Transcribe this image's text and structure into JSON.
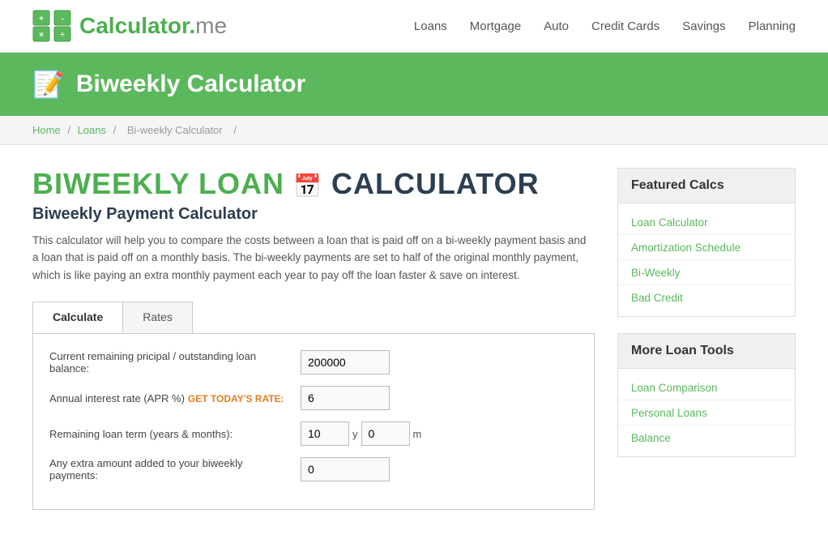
{
  "header": {
    "logo_text": "Calculator",
    "logo_dot": ".",
    "logo_me": "me",
    "nav_items": [
      {
        "label": "Loans",
        "href": "#"
      },
      {
        "label": "Mortgage",
        "href": "#"
      },
      {
        "label": "Auto",
        "href": "#"
      },
      {
        "label": "Credit Cards",
        "href": "#"
      },
      {
        "label": "Savings",
        "href": "#"
      },
      {
        "label": "Planning",
        "href": "#"
      }
    ]
  },
  "banner": {
    "emoji": "📝",
    "title": "Biweekly Calculator"
  },
  "breadcrumb": {
    "home": "Home",
    "loans": "Loans",
    "current": "Bi-weekly Calculator"
  },
  "main": {
    "heading_part1": "BIWEEKLY LOAN",
    "heading_emoji": "📅",
    "heading_part2": "CALCULATOR",
    "subheading": "Biweekly Payment Calculator",
    "description": "This calculator will help you to compare the costs between a loan that is paid off on a bi-weekly payment basis and a loan that is paid off on a monthly basis. The bi-weekly payments are set to half of the original monthly payment, which is like paying an extra monthly payment each year to pay off the loan faster & save on interest.",
    "tabs": [
      {
        "label": "Calculate",
        "active": true
      },
      {
        "label": "Rates",
        "active": false
      }
    ],
    "form_fields": [
      {
        "label": "Current remaining pricipal / outstanding loan balance:",
        "type": "single",
        "value": "200000",
        "placeholder": ""
      },
      {
        "label": "Annual interest rate (APR %)",
        "get_rate_label": "GET TODAY'S RATE:",
        "type": "single",
        "value": "6",
        "placeholder": ""
      },
      {
        "label": "Remaining loan term (years & months):",
        "type": "dual",
        "value1": "10",
        "unit1": "y",
        "value2": "0",
        "unit2": "m"
      },
      {
        "label": "Any extra amount added to your biweekly payments:",
        "type": "single",
        "value": "0",
        "placeholder": ""
      }
    ]
  },
  "sidebar": {
    "featured_calcs": {
      "header": "Featured Calcs",
      "items": [
        {
          "label": "Loan Calculator",
          "href": "#"
        },
        {
          "label": "Amortization Schedule",
          "href": "#"
        },
        {
          "label": "Bi-Weekly",
          "href": "#"
        },
        {
          "label": "Bad Credit",
          "href": "#"
        }
      ]
    },
    "more_loan_tools": {
      "header": "More Loan Tools",
      "items": [
        {
          "label": "Loan Comparison",
          "href": "#"
        },
        {
          "label": "Personal Loans",
          "href": "#"
        },
        {
          "label": "Balance",
          "href": "#"
        }
      ]
    }
  }
}
